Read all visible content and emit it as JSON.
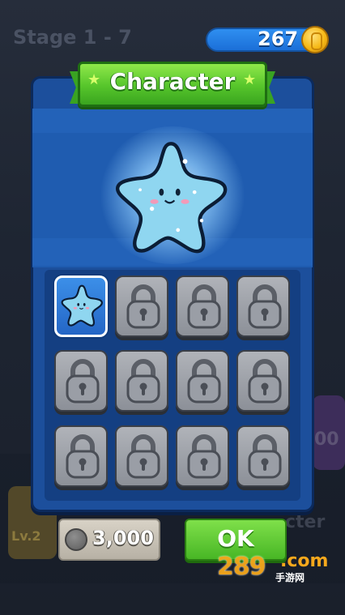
{
  "background": {
    "stage_label": "Stage 1 - 7",
    "left_card_level": "Lv.2",
    "right_card_number": "00",
    "right_card_text": "cter"
  },
  "coins": {
    "value": "267",
    "icon": "gold-coin-icon"
  },
  "dialog": {
    "title": "Character",
    "title_star_icon": "star-icon",
    "selected_character": "blue-star-character",
    "slots": [
      {
        "state": "selected",
        "icon": "blue-star-character-icon"
      },
      {
        "state": "locked",
        "icon": "padlock-icon"
      },
      {
        "state": "locked",
        "icon": "padlock-icon"
      },
      {
        "state": "locked",
        "icon": "padlock-icon"
      },
      {
        "state": "locked",
        "icon": "padlock-icon"
      },
      {
        "state": "locked",
        "icon": "padlock-icon"
      },
      {
        "state": "locked",
        "icon": "padlock-icon"
      },
      {
        "state": "locked",
        "icon": "padlock-icon"
      },
      {
        "state": "locked",
        "icon": "padlock-icon"
      },
      {
        "state": "locked",
        "icon": "padlock-icon"
      },
      {
        "state": "locked",
        "icon": "padlock-icon"
      },
      {
        "state": "locked",
        "icon": "padlock-icon"
      }
    ],
    "price": {
      "value": "3,000",
      "icon": "silver-coin-icon"
    },
    "ok_label": "OK"
  },
  "watermark": {
    "text": "289",
    "suffix": ".com",
    "subtitle": "手游网"
  },
  "colors": {
    "panel": "#1c4f9c",
    "ribbon": "#56c52b",
    "ok_button": "#48b625",
    "coin_bar": "#2f8ff0",
    "coin": "#f6b917",
    "character": "#8fd6f0"
  }
}
